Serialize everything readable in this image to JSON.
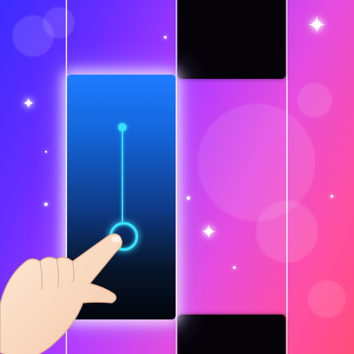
{
  "game": {
    "type": "piano-tiles",
    "lanes": 4,
    "tiles": [
      {
        "lane": 2,
        "row": "top",
        "kind": "black"
      },
      {
        "lane": 1,
        "row": "middle",
        "kind": "hold",
        "state": "being-pressed"
      },
      {
        "lane": 2,
        "row": "bottom",
        "kind": "black"
      }
    ]
  },
  "icons": {
    "hand": "pointing-hand-icon",
    "sparkle": "sparkle-icon"
  },
  "colors": {
    "hold_tile_top": "#1e7cff",
    "hold_tile_bottom": "#02050c",
    "hold_indicator": "#38e1ff",
    "black_tile": "#050308",
    "background_left": "#3b2cff",
    "background_right": "#ff4d7a"
  }
}
